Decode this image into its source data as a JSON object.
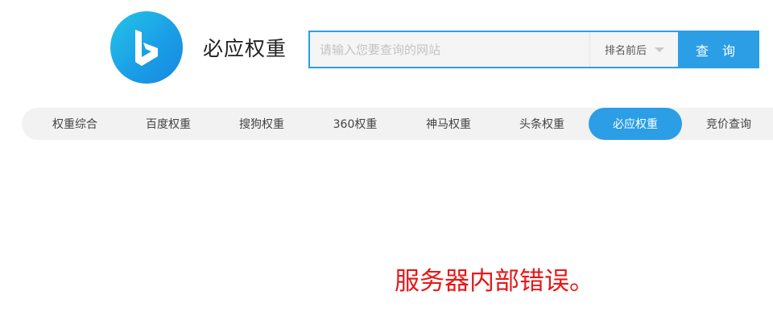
{
  "header": {
    "logo_icon": "bing-b-icon",
    "title": "必应权重"
  },
  "search": {
    "placeholder": "请输入您要查询的网站",
    "value": "",
    "rank_select_label": "排名前后",
    "query_button_label": "查 询"
  },
  "nav": {
    "items": [
      {
        "label": "权重综合",
        "active": false
      },
      {
        "label": "百度权重",
        "active": false
      },
      {
        "label": "搜狗权重",
        "active": false
      },
      {
        "label": "360权重",
        "active": false
      },
      {
        "label": "神马权重",
        "active": false
      },
      {
        "label": "头条权重",
        "active": false
      },
      {
        "label": "必应权重",
        "active": true
      },
      {
        "label": "竞价查询",
        "active": false
      }
    ]
  },
  "main": {
    "error_message": "服务器内部错误。"
  },
  "colors": {
    "accent": "#2b9ee6",
    "error": "#e61818",
    "nav_bg": "#f2f2f2"
  }
}
